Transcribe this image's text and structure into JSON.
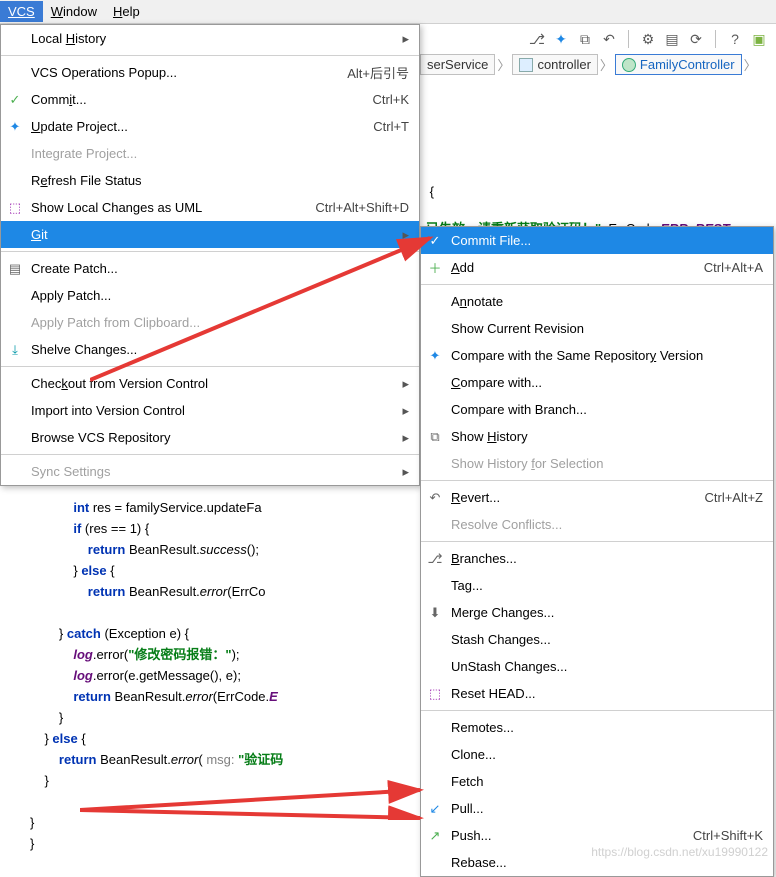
{
  "menubar": {
    "vcs": "VCS",
    "window": "Window",
    "help": "Help"
  },
  "breadcrumb": {
    "a": "serService",
    "b": "controller",
    "c": "FamilyController"
  },
  "menu1": {
    "local_history": "Local History",
    "vcs_popup": "VCS Operations Popup...",
    "vcs_popup_sc": "Alt+后引号",
    "commit": "Commit...",
    "commit_sc": "Ctrl+K",
    "update": "Update Project...",
    "update_sc": "Ctrl+T",
    "integrate": "Integrate Project...",
    "refresh": "Refresh File Status",
    "uml": "Show Local Changes as UML",
    "uml_sc": "Ctrl+Alt+Shift+D",
    "git": "Git",
    "create_patch": "Create Patch...",
    "apply_patch": "Apply Patch...",
    "apply_clip": "Apply Patch from Clipboard...",
    "shelve": "Shelve Changes...",
    "checkout": "Checkout from Version Control",
    "import_vc": "Import into Version Control",
    "browse": "Browse VCS Repository",
    "sync": "Sync Settings"
  },
  "menu2": {
    "commit_file": "Commit File...",
    "add": "Add",
    "add_sc": "Ctrl+Alt+A",
    "annotate": "Annotate",
    "show_rev": "Show Current Revision",
    "compare_same": "Compare with the Same Repository Version",
    "compare_with": "Compare with...",
    "compare_branch": "Compare with Branch...",
    "show_history": "Show History",
    "show_history_sel": "Show History for Selection",
    "revert": "Revert...",
    "revert_sc": "Ctrl+Alt+Z",
    "resolve": "Resolve Conflicts...",
    "branches": "Branches...",
    "tag": "Tag...",
    "merge": "Merge Changes...",
    "stash": "Stash Changes...",
    "unstash": "UnStash Changes...",
    "reset_head": "Reset HEAD...",
    "remotes": "Remotes...",
    "clone": "Clone...",
    "fetch": "Fetch",
    "pull": "Pull...",
    "push": "Push...",
    "push_sc": "Ctrl+Shift+K",
    "rebase": "Rebase..."
  },
  "bgcode": {
    "brace": " {",
    "line": "已失效，请重新获取验证码！\"",
    "errc": ", ErrCode.",
    "errv": "ERR_REST"
  },
  "code": {
    "l1a": "int",
    "l1b": " res = familyService.updateFa",
    "l2a": "if",
    "l2b": " (res == 1) {",
    "l3a": "return",
    "l3b": " BeanResult.",
    "l3c": "success",
    "l3d": "();",
    "l4a": "} ",
    "l4b": "else",
    "l4c": " {",
    "l5a": "return",
    "l5b": " BeanResult.",
    "l5c": "error",
    "l5d": "(ErrCo",
    "l6": "} ",
    "l7a": "catch",
    "l7b": " (Exception e) {",
    "l8a": "log",
    "l8b": ".error(",
    "l8c": "\"修改密码报错：\"",
    "l8d": ");",
    "l9a": "log",
    "l9b": ".error(e.getMessage(), e);",
    "l10a": "return",
    "l10b": " BeanResult.",
    "l10c": "error",
    "l10d": "(ErrCode.",
    "l10e": "E",
    "l11": "}",
    "l12a": "} ",
    "l12b": "else",
    "l12c": " {",
    "l13a": "return",
    "l13b": " BeanResult.",
    "l13c": "error",
    "l13d": "( ",
    "l13e": "msg:",
    "l13f": " \"验证码",
    "l14": "}",
    "l15": "}",
    "l16": "}"
  },
  "watermark": "https://blog.csdn.net/xu19990122"
}
